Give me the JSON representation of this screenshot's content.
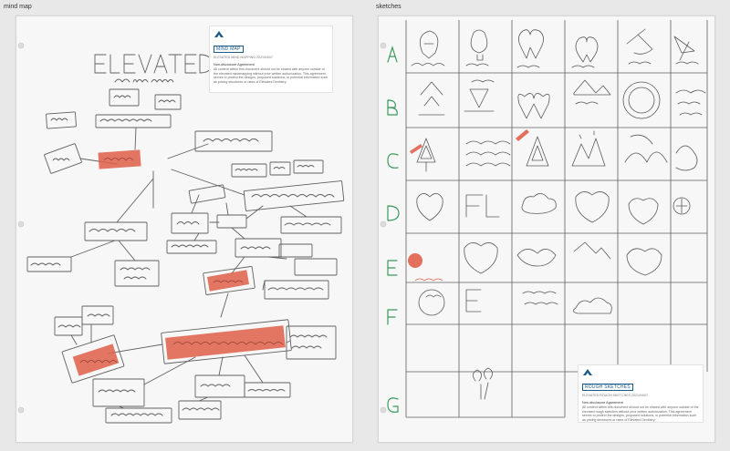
{
  "frames": {
    "mindmap": {
      "label": "mind map",
      "card": {
        "title": "MIND MAP",
        "subtitle": "ELEVATED MIND MAPPING 2021/04/07",
        "heading": "Non-disclosure Agreement",
        "body": "All content within this document should not be shared with anyone outside of the elevated mindmapping without prior written authorization. This agreement serves to protect the designs, proposed solutions, or potential information such as pricing structures or rates of Elevated Dentistry."
      }
    },
    "sketches": {
      "label": "sketches",
      "card": {
        "title": "ROUGH SKETCHES",
        "subtitle": "ELEVATED ROUGH SKETCHES 2021/04/07",
        "heading": "Non-disclosure Agreement",
        "body": "All content within this document should not be shared with anyone outside of the elevated rough sketches without prior written authorization. This agreement serves to protect the designs, proposed solutions, or potential information such as pricing structures or rates of Elevated Dentistry."
      }
    }
  },
  "colors": {
    "canvas": "#e8e8e8",
    "pencil": "#555555",
    "highlight": "#e0604a",
    "ink_green": "#3b9a5a",
    "brand_blue": "#1b5a8a"
  },
  "icons": [
    "logo-mountain-icon"
  ]
}
